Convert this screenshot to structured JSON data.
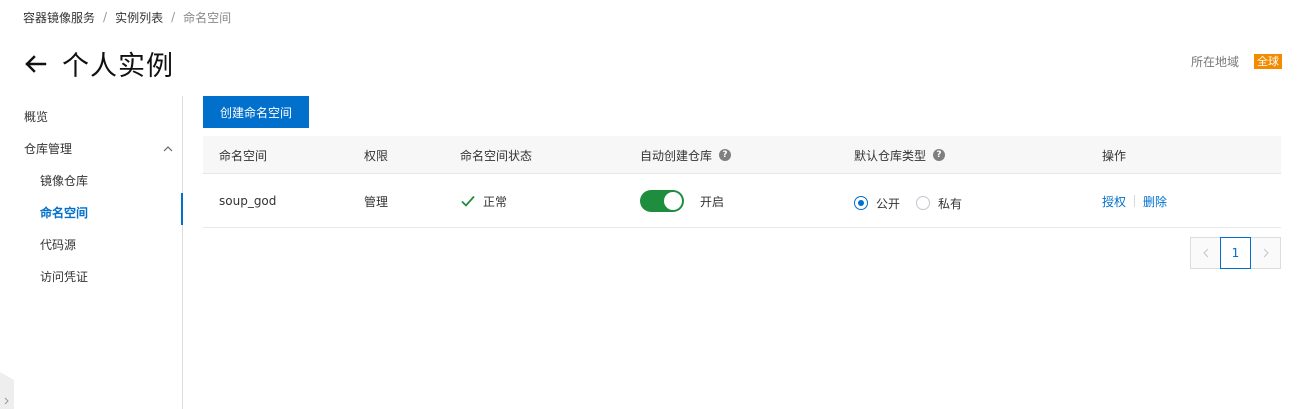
{
  "breadcrumb": [
    "容器镜像服务",
    "实例列表",
    "命名空间"
  ],
  "header": {
    "title": "个人实例",
    "region_label": "所在地域",
    "region_badge": "全球"
  },
  "sidebar": {
    "overview": "概览",
    "group_label": "仓库管理",
    "items": [
      "镜像仓库",
      "命名空间",
      "代码源",
      "访问凭证"
    ],
    "active_index": 1
  },
  "toolbar": {
    "create_label": "创建命名空间"
  },
  "table": {
    "columns": [
      "命名空间",
      "权限",
      "命名空间状态",
      "自动创建仓库",
      "默认仓库类型",
      "操作"
    ],
    "help_icons": [
      "自动创建仓库",
      "默认仓库类型"
    ],
    "rows": [
      {
        "namespace": "soup_god",
        "permission": "管理",
        "status": "正常",
        "auto_create_on": true,
        "auto_create_text": "开启",
        "repo_type_options": [
          "公开",
          "私有"
        ],
        "repo_type_selected": "公开",
        "actions": [
          "授权",
          "删除"
        ]
      }
    ]
  },
  "pagination": {
    "current_page": "1"
  },
  "colors": {
    "primary": "#0070cc",
    "success": "#1e8e3e",
    "badge": "#f28b00"
  }
}
